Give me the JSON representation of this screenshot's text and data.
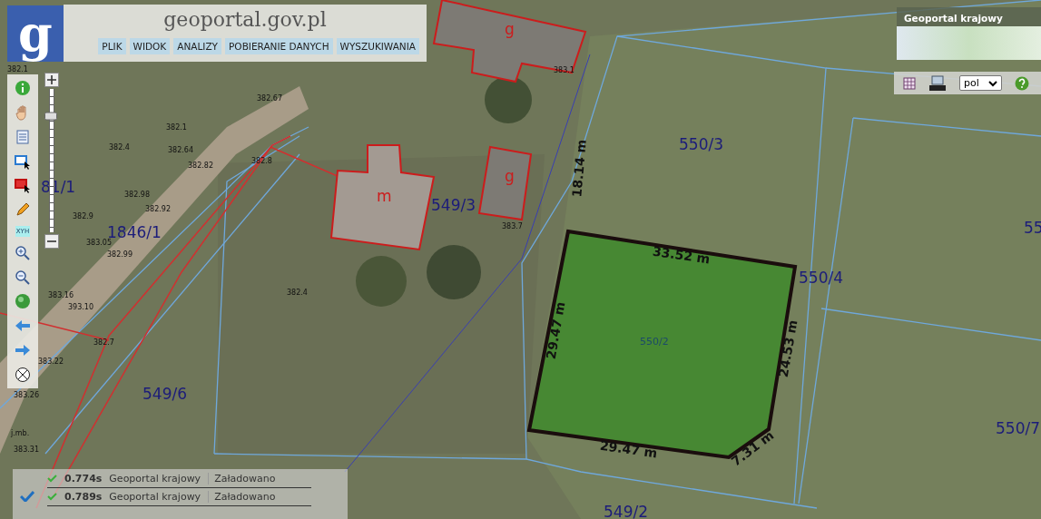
{
  "header": {
    "logo_letter": "g",
    "site_name": "geoportal.gov.pl",
    "menu": [
      "PLIK",
      "WIDOK",
      "ANALIZY",
      "POBIERANIE DANYCH",
      "WYSZUKIWANIA"
    ]
  },
  "toolbar": {
    "coordinates_label": "XYH"
  },
  "zoom_slider": {
    "level": 0.85
  },
  "overview_map": {
    "title": "Geoportal krajowy"
  },
  "map_tools": {
    "language": "pol"
  },
  "map": {
    "parcel_labels": [
      "81/1",
      "1846/1",
      "549/3",
      "550/3",
      "550/4",
      "549/6",
      "550/7",
      "55",
      "549/2"
    ],
    "building_labels": [
      "g",
      "m",
      "g"
    ],
    "elevations": [
      "382.1",
      "382.4",
      "382.64",
      "382.82",
      "382.98",
      "382.92",
      "382.9",
      "383.05",
      "382.99",
      "383.16",
      "393.10",
      "382.7",
      "383.22",
      "383.26",
      "j.mb.",
      "383.31",
      "382.67",
      "382.8",
      "382.4",
      "383.7",
      "383.1",
      "382.1"
    ],
    "selected_parcel": {
      "label": "550/2",
      "measurements": [
        "33.52 m",
        "29.47 m",
        "24.53 m",
        "29.47 m",
        "7.31 m"
      ]
    },
    "distance": "18.14 m"
  },
  "status_log": [
    {
      "time": "0.774s",
      "source": "Geoportal krajowy",
      "status": "Załadowano"
    },
    {
      "time": "0.789s",
      "source": "Geoportal krajowy",
      "status": "Załadowano"
    }
  ]
}
